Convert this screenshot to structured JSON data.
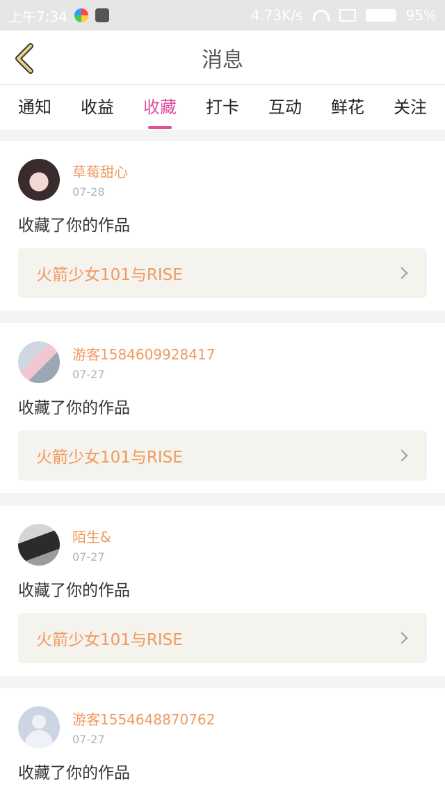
{
  "status": {
    "time": "上午7:34",
    "speed": "4.73K/s",
    "battery": "95%"
  },
  "header": {
    "title": "消息",
    "back": "back"
  },
  "tabs": [
    {
      "label": "通知",
      "active": false
    },
    {
      "label": "收益",
      "active": false
    },
    {
      "label": "收藏",
      "active": true
    },
    {
      "label": "打卡",
      "active": false
    },
    {
      "label": "互动",
      "active": false
    },
    {
      "label": "鲜花",
      "active": false
    },
    {
      "label": "关注",
      "active": false
    }
  ],
  "items": [
    {
      "name": "草莓甜心",
      "date": "07-28",
      "action": "收藏了你的作品",
      "work": "火箭少女101与RISE"
    },
    {
      "name": "游客1584609928417",
      "date": "07-27",
      "action": "收藏了你的作品",
      "work": "火箭少女101与RISE"
    },
    {
      "name": "陌生&",
      "date": "07-27",
      "action": "收藏了你的作品",
      "work": "火箭少女101与RISE"
    },
    {
      "name": "游客1554648870762",
      "date": "07-27",
      "action": "收藏了你的作品",
      "work": ""
    }
  ]
}
